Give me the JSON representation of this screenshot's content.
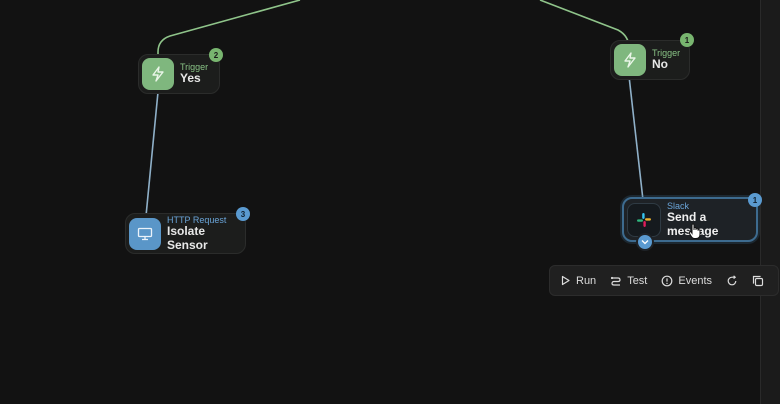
{
  "nodes": {
    "trigger_yes": {
      "kind": "Trigger",
      "name": "Yes",
      "badge": "2"
    },
    "trigger_no": {
      "kind": "Trigger",
      "name": "No",
      "badge": "1"
    },
    "http_request": {
      "kind": "HTTP Request",
      "name": "Isolate Sensor",
      "badge": "3"
    },
    "slack": {
      "kind": "Slack",
      "name": "Send a message",
      "badge": "1"
    }
  },
  "toolbar": {
    "run_label": "Run",
    "test_label": "Test",
    "events_label": "Events"
  },
  "icons": {
    "trigger": "lightning-icon",
    "http": "monitor-icon",
    "slack": "slack-icon",
    "run": "play-icon",
    "test": "test-icon",
    "events": "info-icon",
    "refresh": "refresh-icon",
    "copy": "copy-icon"
  },
  "colors": {
    "background": "#121212",
    "trigger_accent": "#7fb77e",
    "http_accent": "#5a96c8",
    "slack_border": "#3d6b8f"
  }
}
